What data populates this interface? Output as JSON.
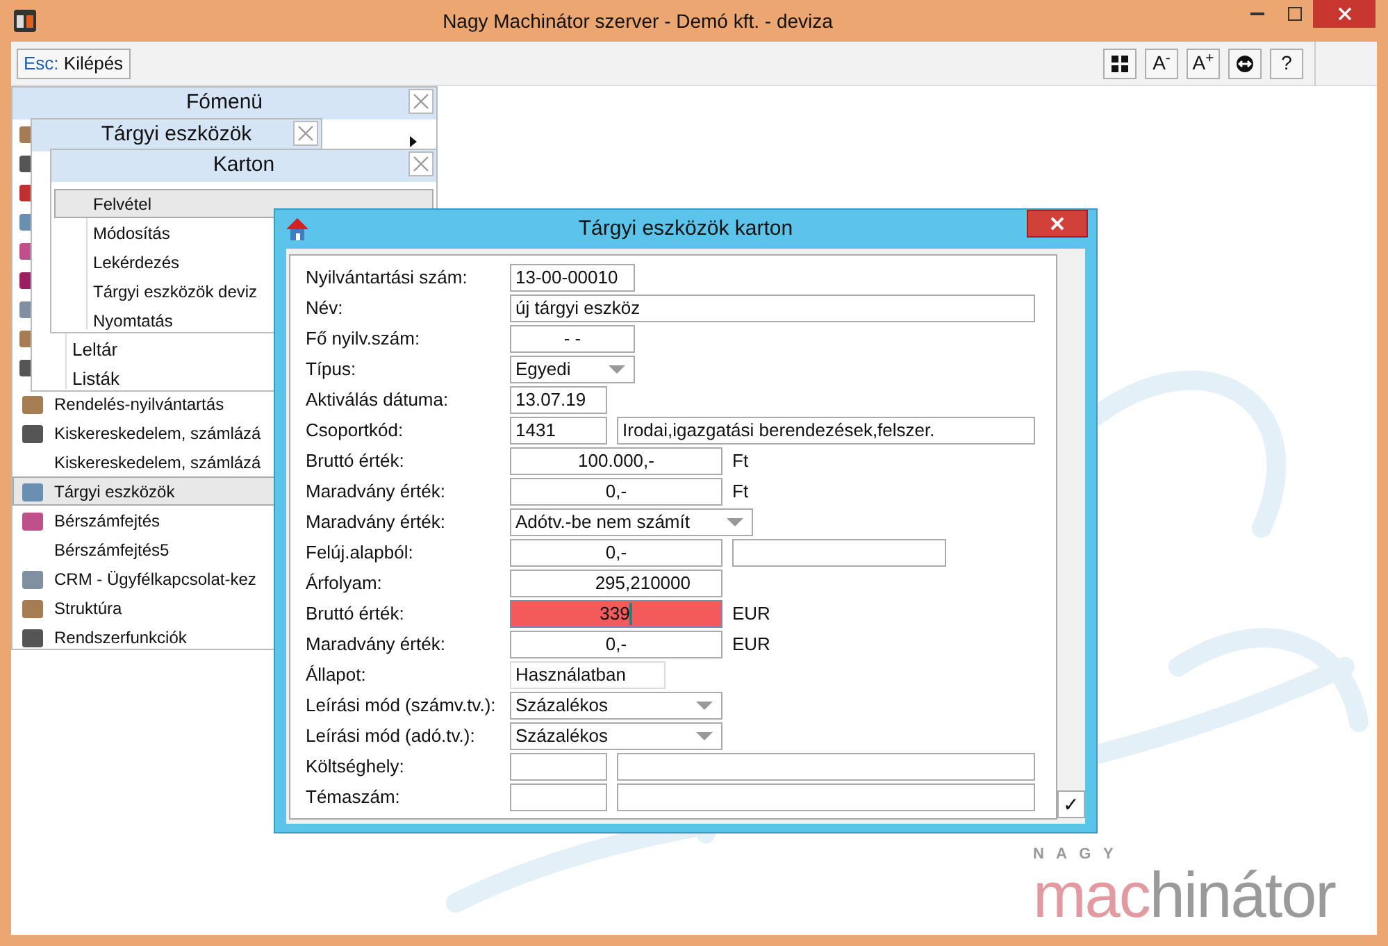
{
  "window": {
    "title": "Nagy Machinátor szerver - Demó kft. - deviza"
  },
  "toolbar": {
    "exit_button": {
      "key": "Esc:",
      "label": "Kilépés"
    },
    "buttons": [
      {
        "kind": "grid"
      },
      {
        "kind": "text",
        "label": "A$^{-}$"
      },
      {
        "kind": "text",
        "label": "A$^{+}$"
      },
      {
        "kind": "circle"
      },
      {
        "kind": "text",
        "label": "?"
      }
    ]
  },
  "main_menu": {
    "title": "Fómenü",
    "items": [
      {
        "label": "Rendelés-nyilvántartás",
        "icon": true,
        "selected": false
      },
      {
        "label": "Kiskereskedelem, számlázá",
        "icon": true,
        "selected": false
      },
      {
        "label": "Kiskereskedelem, számlázá",
        "icon": false,
        "selected": false
      },
      {
        "label": "Tárgyi eszközök",
        "icon": true,
        "selected": true
      },
      {
        "label": "Bérszámfejtés",
        "icon": true,
        "selected": false
      },
      {
        "label": "Bérszámfejtés5",
        "icon": false,
        "selected": false
      },
      {
        "label": "CRM - Ügyfélkapcsolat-kez",
        "icon": true,
        "selected": false
      },
      {
        "label": "Struktúra",
        "icon": true,
        "selected": false
      },
      {
        "label": "Rendszerfunkciók",
        "icon": true,
        "selected": false
      }
    ]
  },
  "submenu": {
    "title": "Tárgyi eszközök",
    "items": [
      {
        "label": "Leltár",
        "selected": false
      },
      {
        "label": "Listák",
        "selected": false
      }
    ]
  },
  "karton_menu": {
    "title": "Karton",
    "items": [
      {
        "label": "Felvétel",
        "selected": true
      },
      {
        "label": "Módosítás",
        "selected": false
      },
      {
        "label": "Lekérdezés",
        "selected": false
      },
      {
        "label": "Tárgyi eszközök deviz",
        "selected": false
      },
      {
        "label": "Nyomtatás",
        "selected": false
      }
    ]
  },
  "dialog": {
    "title": "Tárgyi eszközök karton",
    "rows": [
      {
        "label": "Nyilvántartási szám:",
        "kind": "text",
        "inputs": [
          {
            "value": "13-00-00010",
            "invalid": false
          }
        ]
      },
      {
        "label": "Név:",
        "kind": "text",
        "inputs": [
          {
            "value": "új tárgyi eszköz",
            "invalid": false
          }
        ]
      },
      {
        "label": "Fő nyilv.szám:",
        "kind": "text",
        "inputs": [
          {
            "value": "-  -",
            "invalid": false
          }
        ]
      },
      {
        "label": "Típus:",
        "kind": "select",
        "inputs": [
          {
            "value": "Egyedi",
            "invalid": false
          }
        ]
      },
      {
        "label": "Aktiválás dátuma:",
        "kind": "text",
        "inputs": [
          {
            "value": "13.07.19",
            "invalid": false
          }
        ]
      },
      {
        "label": "Csoportkód:",
        "kind": "text",
        "inputs": [
          {
            "value": "1431",
            "invalid": false
          },
          {
            "value": "Irodai,igazgatási berendezések,felszer.",
            "invalid": false
          }
        ]
      },
      {
        "label": "Bruttó érték:",
        "kind": "text",
        "inputs": [
          {
            "value": "100.000,-",
            "invalid": false
          }
        ],
        "unit": "Ft"
      },
      {
        "label": "Maradvány érték:",
        "kind": "text",
        "inputs": [
          {
            "value": "0,-",
            "invalid": false
          }
        ],
        "unit": "Ft"
      },
      {
        "label": "Maradvány érték:",
        "kind": "select",
        "inputs": [
          {
            "value": "Adótv.-be nem számít",
            "invalid": false
          }
        ]
      },
      {
        "label": "Felúj.alapból:",
        "kind": "text",
        "inputs": [
          {
            "value": "0,-",
            "invalid": false
          },
          {
            "invalid": false
          }
        ]
      },
      {
        "label": "Árfolyam:",
        "kind": "text",
        "inputs": [
          {
            "value": "295,210000",
            "invalid": false
          }
        ]
      },
      {
        "label": "Bruttó érték:",
        "kind": "text",
        "inputs": [
          {
            "value": "339",
            "invalid": true
          }
        ],
        "unit": "EUR"
      },
      {
        "label": "Maradvány érték:",
        "kind": "text",
        "inputs": [
          {
            "value": "0,-",
            "invalid": false
          }
        ],
        "unit": "EUR"
      },
      {
        "label": "Állapot:",
        "kind": "readonly",
        "inputs": [
          {
            "value": "Használatban",
            "invalid": false
          }
        ]
      },
      {
        "label": "Leírási mód (számv.tv.):",
        "kind": "select",
        "inputs": [
          {
            "value": "Százalékos",
            "invalid": false
          }
        ]
      },
      {
        "label": "Leírási mód (adó.tv.):",
        "kind": "select",
        "inputs": [
          {
            "value": "Százalékos",
            "invalid": false
          }
        ]
      },
      {
        "label": "Költséghely:",
        "kind": "text",
        "inputs": [
          {
            "invalid": false
          },
          {
            "invalid": false
          }
        ]
      },
      {
        "label": "Témaszám:",
        "kind": "text",
        "inputs": [
          {
            "invalid": false
          },
          {
            "invalid": false
          }
        ]
      }
    ],
    "ok_button": "✓"
  },
  "logo": {
    "top": "N A G Y",
    "brand_first": "mac",
    "brand_rest": "hinátor"
  }
}
